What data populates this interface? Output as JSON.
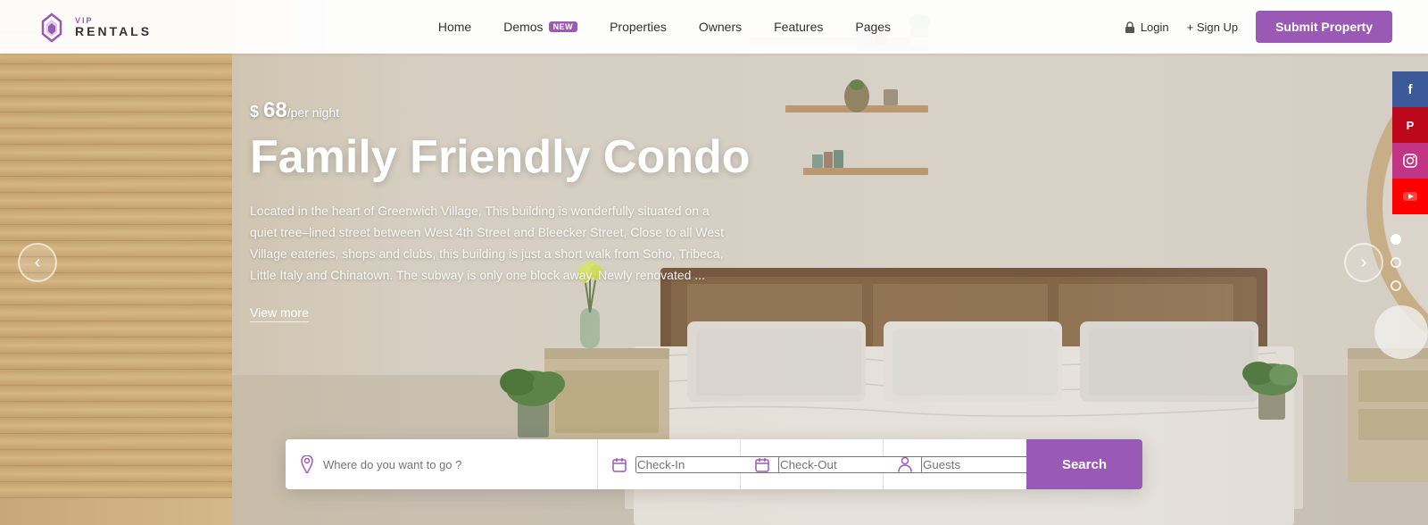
{
  "logo": {
    "top": "VIP",
    "bottom": "RENTALS"
  },
  "nav": {
    "links": [
      {
        "label": "Home",
        "badge": null
      },
      {
        "label": "Demos",
        "badge": "new"
      },
      {
        "label": "Properties",
        "badge": null
      },
      {
        "label": "Owners",
        "badge": null
      },
      {
        "label": "Features",
        "badge": null
      },
      {
        "label": "Pages",
        "badge": null
      }
    ],
    "login_label": "Login",
    "signup_label": "+ Sign Up",
    "submit_label": "Submit Property"
  },
  "hero": {
    "price_symbol": "$",
    "price_amount": "68",
    "price_per": "/per night",
    "title": "Family Friendly Condo",
    "description": "Located in the heart of Greenwich Village, This building is wonderfully situated on a quiet tree–lined street between West 4th Street and Bleecker Street, Close to all West Village eateries, shops and clubs, this building is just a short walk from Soho, Tribeca, Little Italy and Chinatown. The subway is only one block away. Newly renovated ...",
    "view_more": "View more",
    "slider_dots": [
      {
        "active": true
      },
      {
        "active": false
      },
      {
        "active": false
      }
    ],
    "arrow_left": "‹",
    "arrow_right": "›"
  },
  "social": [
    {
      "name": "facebook",
      "label": "f"
    },
    {
      "name": "pinterest",
      "label": "P"
    },
    {
      "name": "instagram",
      "label": "ig"
    },
    {
      "name": "youtube",
      "label": "▶"
    }
  ],
  "search": {
    "location_placeholder": "Where do you want to go ?",
    "checkin_placeholder": "Check-In",
    "checkout_placeholder": "Check-Out",
    "guests_placeholder": "Guests",
    "search_button_label": "Search"
  }
}
